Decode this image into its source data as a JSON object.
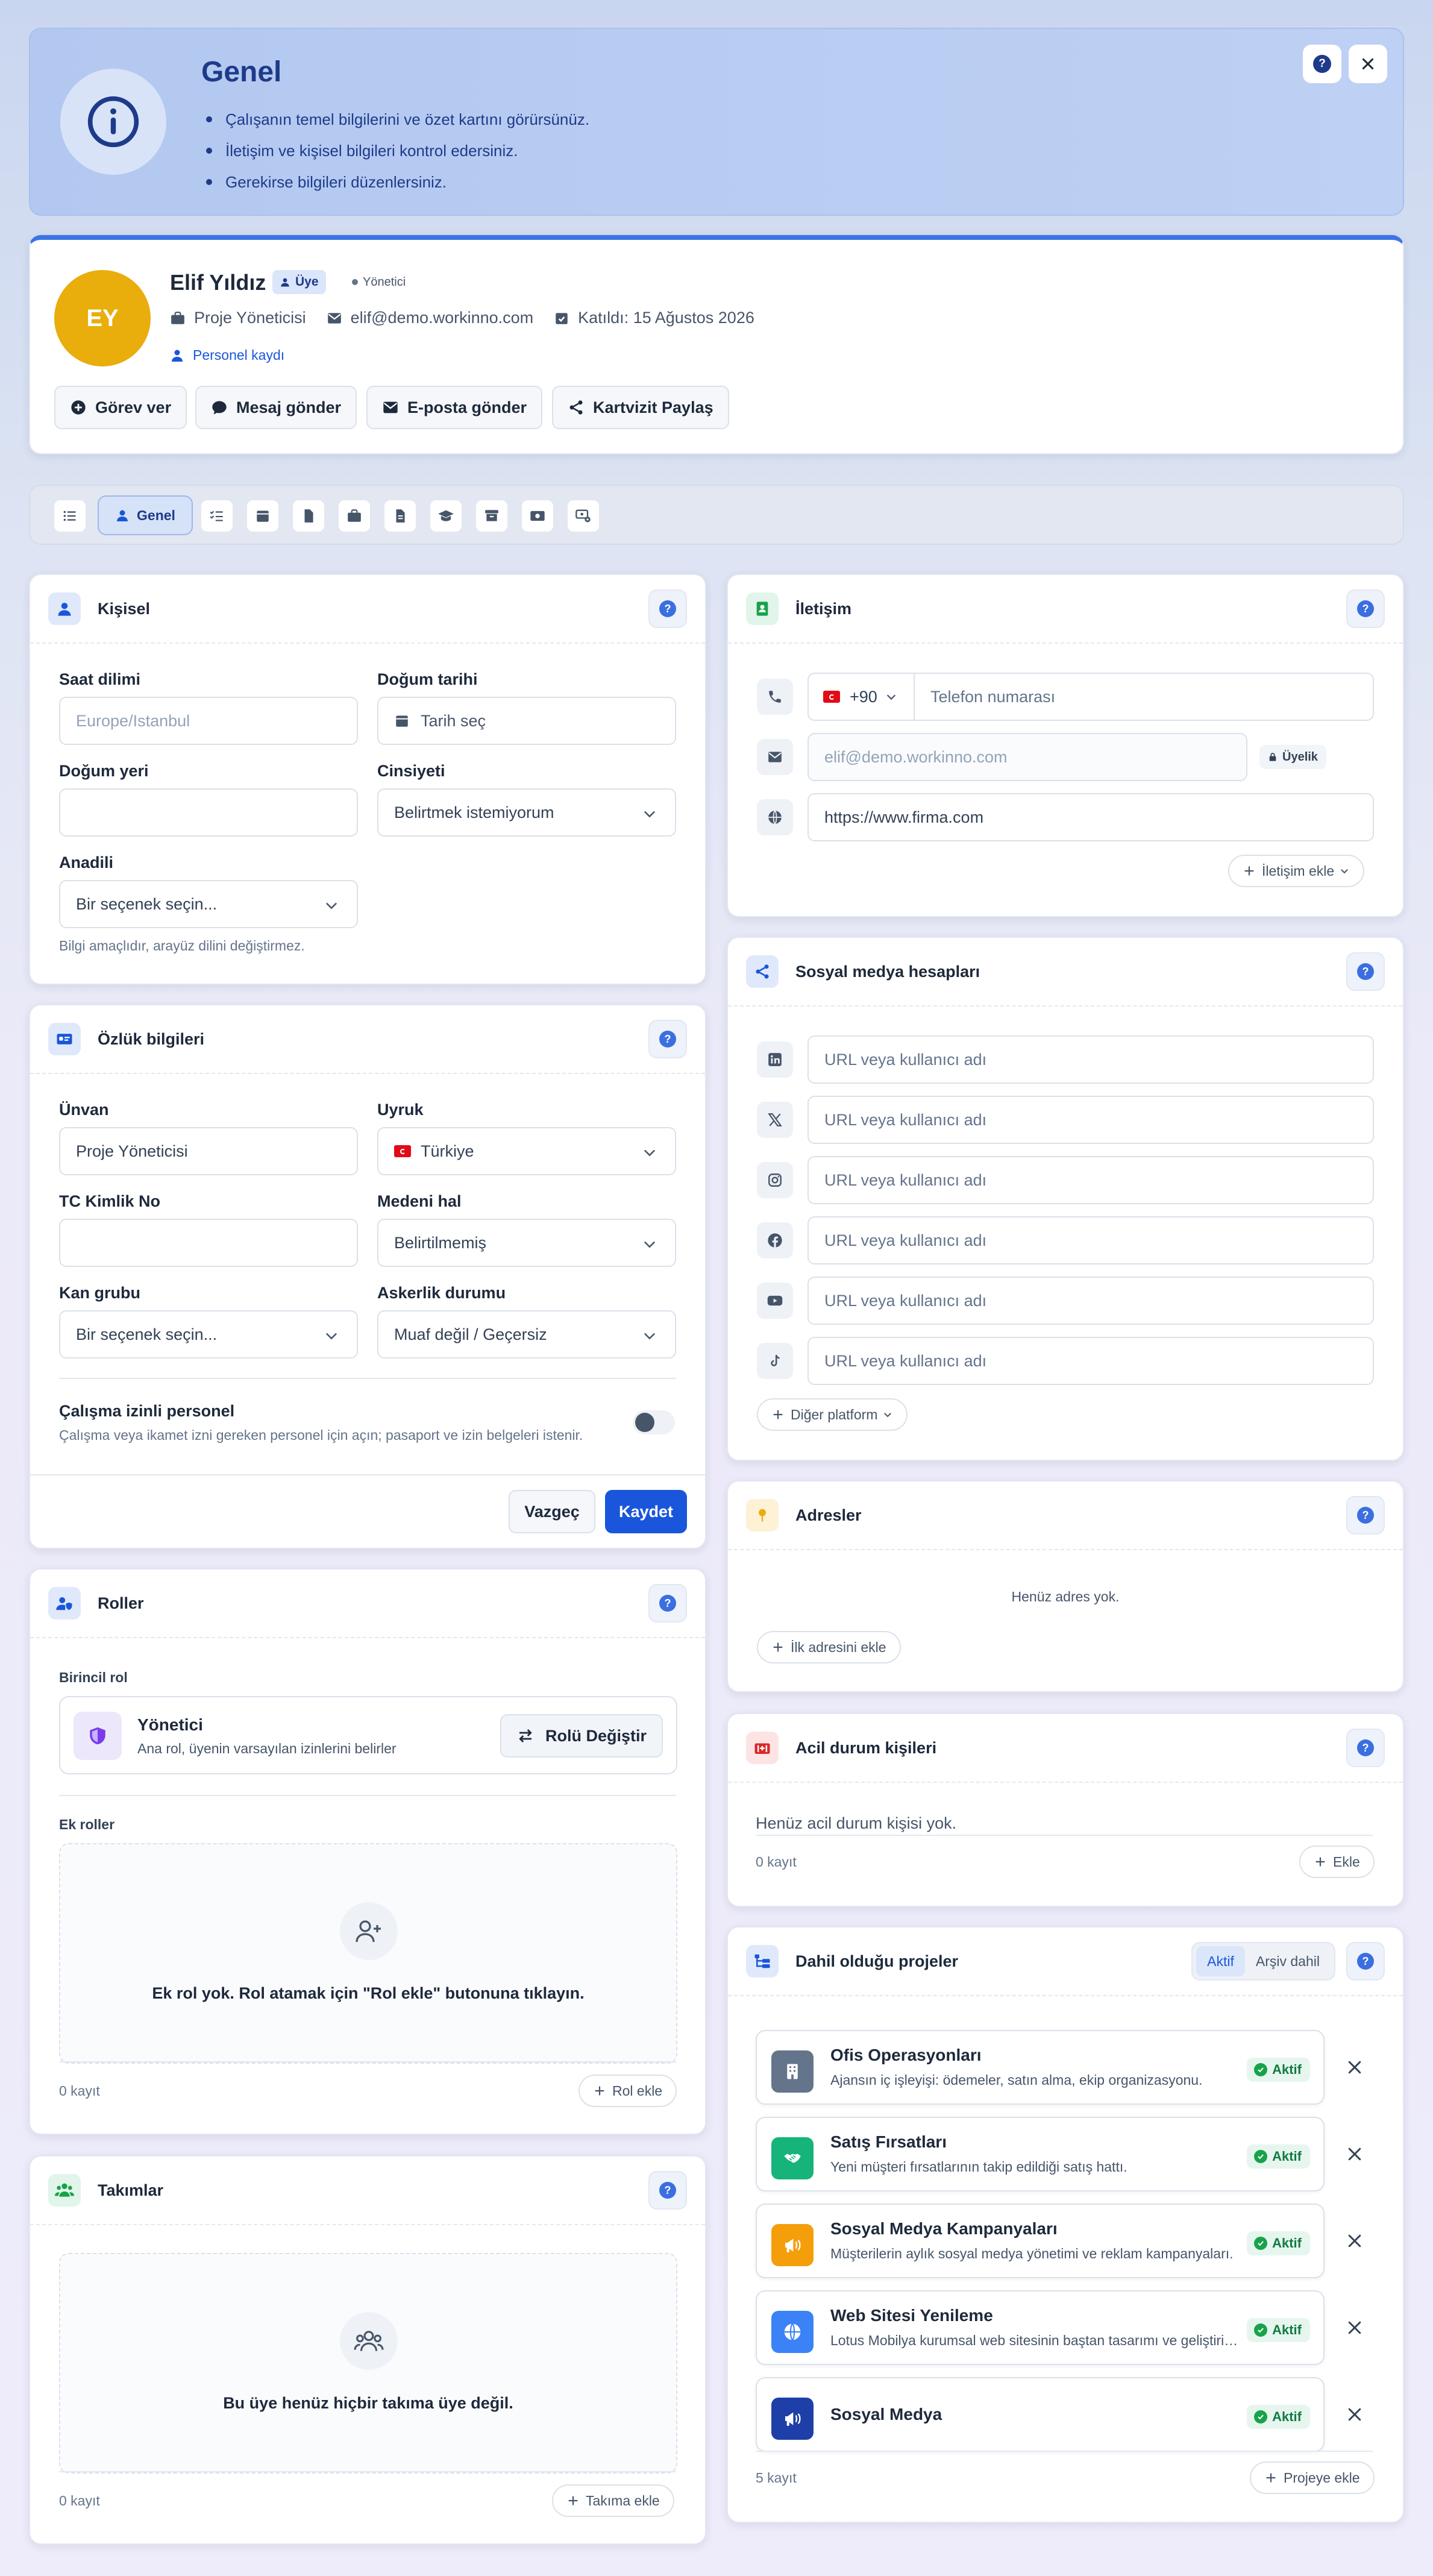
{
  "banner": {
    "title": "Genel",
    "bullets": [
      "Çalışanın temel bilgilerini ve özet kartını görürsünüz.",
      "İletişim ve kişisel bilgileri kontrol edersiniz.",
      "Gerekirse bilgileri düzenlersiniz."
    ]
  },
  "profile": {
    "initials": "EY",
    "name": "Elif Yıldız",
    "member_badge": "Üye",
    "role_tag": "Yönetici",
    "job_title": "Proje Yöneticisi",
    "email": "elif@demo.workinno.com",
    "joined": "Katıldı: 15 Ağustos 2026",
    "record_link": "Personel kaydı",
    "actions": [
      "Görev ver",
      "Mesaj gönder",
      "E-posta gönder",
      "Kartvizit Paylaş"
    ]
  },
  "tabs": {
    "active_label": "Genel"
  },
  "personal": {
    "title": "Kişisel",
    "timezone_label": "Saat dilimi",
    "timezone_placeholder": "Europe/Istanbul",
    "birthdate_label": "Doğum tarihi",
    "birthdate_placeholder": "Tarih seç",
    "birthplace_label": "Doğum yeri",
    "birthplace_value": "",
    "gender_label": "Cinsiyeti",
    "gender_value": "Belirtmek istemiyorum",
    "language_label": "Anadili",
    "language_value": "Bir seçenek seçin...",
    "language_help": "Bilgi amaçlıdır, arayüz dilini değiştirmez."
  },
  "hr": {
    "title": "Özlük bilgileri",
    "title_label": "Ünvan",
    "title_value": "Proje Yöneticisi",
    "nationality_label": "Uyruk",
    "nationality_value": "Türkiye",
    "tc_label": "TC Kimlik No",
    "tc_value": "",
    "marital_label": "Medeni hal",
    "marital_value": "Belirtilmemiş",
    "blood_label": "Kan grubu",
    "blood_value": "Bir seçenek seçin...",
    "military_label": "Askerlik durumu",
    "military_value": "Muaf değil / Geçersiz",
    "permit_title": "Çalışma izinli personel",
    "permit_help": "Çalışma veya ikamet izni gereken personel için açın; pasaport ve izin belgeleri istenir.",
    "cancel": "Vazgeç",
    "save": "Kaydet"
  },
  "roles": {
    "title": "Roller",
    "primary_label": "Birincil rol",
    "primary_name": "Yönetici",
    "primary_desc": "Ana rol, üyenin varsayılan izinlerini belirler",
    "change_button": "Rolü Değiştir",
    "extra_label": "Ek roller",
    "empty_text": "Ek rol yok. Rol atamak için \"Rol ekle\" butonuna tıklayın.",
    "count": "0 kayıt",
    "add_button": "Rol ekle"
  },
  "teams": {
    "title": "Takımlar",
    "empty_text": "Bu üye henüz hiçbir takıma üye değil.",
    "count": "0 kayıt",
    "add_button": "Takıma ekle"
  },
  "contact": {
    "title": "İletişim",
    "country_code": "+90",
    "phone_placeholder": "Telefon numarası",
    "email_placeholder": "elif@demo.workinno.com",
    "email_badge": "Üyelik",
    "website_value": "https://www.firma.com",
    "add_button": "İletişim ekle"
  },
  "social": {
    "title": "Sosyal medya hesapları",
    "placeholder": "URL veya kullanıcı adı",
    "platforms": [
      "linkedin-icon",
      "x-icon",
      "instagram-icon",
      "facebook-icon",
      "youtube-icon",
      "tiktok-icon"
    ],
    "other_button": "Diğer platform"
  },
  "addresses": {
    "title": "Adresler",
    "empty_text": "Henüz adres yok.",
    "add_button": "İlk adresini ekle"
  },
  "emergency": {
    "title": "Acil durum kişileri",
    "empty_text": "Henüz acil durum kişisi yok.",
    "count": "0 kayıt",
    "add_button": "Ekle"
  },
  "projects": {
    "title": "Dahil olduğu projeler",
    "filter_active": "Aktif",
    "filter_archived": "Arşiv dahil",
    "items": [
      {
        "name": "Ofis Operasyonları",
        "desc": "Ajansın iç işleyişi: ödemeler, satın alma, ekip organizasyonu.",
        "status": "Aktif",
        "color": "#64748b",
        "icon": "building-icon"
      },
      {
        "name": "Satış Fırsatları",
        "desc": "Yeni müşteri fırsatlarının takip edildiği satış hattı.",
        "status": "Aktif",
        "color": "#16b47a",
        "icon": "handshake-icon"
      },
      {
        "name": "Sosyal Medya Kampanyaları",
        "desc": "Müşterilerin aylık sosyal medya yönetimi ve reklam kampanyaları.",
        "status": "Aktif",
        "color": "#f59e0b",
        "icon": "megaphone-icon"
      },
      {
        "name": "Web Sitesi Yenileme",
        "desc": "Lotus Mobilya kurumsal web sitesinin baştan tasarımı ve geliştirilmesi.",
        "status": "Aktif",
        "color": "#3b82f6",
        "icon": "globe-icon"
      },
      {
        "name": "Sosyal Medya",
        "desc": "",
        "status": "Aktif",
        "color": "#1e3fa8",
        "icon": "megaphone-icon"
      }
    ],
    "count": "5 kayıt",
    "add_button": "Projeye ekle"
  },
  "colors": {
    "primary": "#1a56db",
    "banner": "#b7cbf1",
    "accent_gold": "#e9ad0c"
  }
}
